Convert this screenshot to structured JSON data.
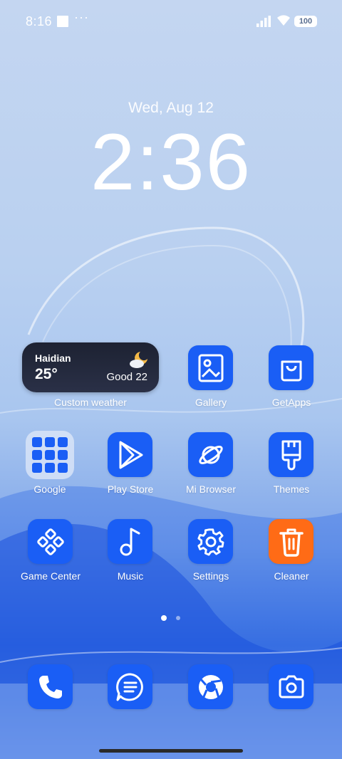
{
  "status_bar": {
    "time": "8:16",
    "battery": "100"
  },
  "lockscreen": {
    "date": "Wed, Aug 12",
    "clock": "2:36"
  },
  "weather_widget": {
    "city": "Haidian",
    "temperature": "25°",
    "air_quality": "Good 22",
    "label": "Custom weather",
    "icon": "partly-cloudy-night-icon"
  },
  "apps": {
    "gallery": "Gallery",
    "getapps": "GetApps",
    "google": "Google",
    "play_store": "Play Store",
    "mi_browser": "Mi Browser",
    "themes": "Themes",
    "game_center": "Game Center",
    "music": "Music",
    "settings": "Settings",
    "cleaner": "Cleaner"
  },
  "dock": [
    "phone-icon",
    "messages-icon",
    "chrome-icon",
    "camera-icon"
  ],
  "colors": {
    "accent_blue": "#1a5ef5",
    "cleaner_orange": "#ff6b16"
  }
}
